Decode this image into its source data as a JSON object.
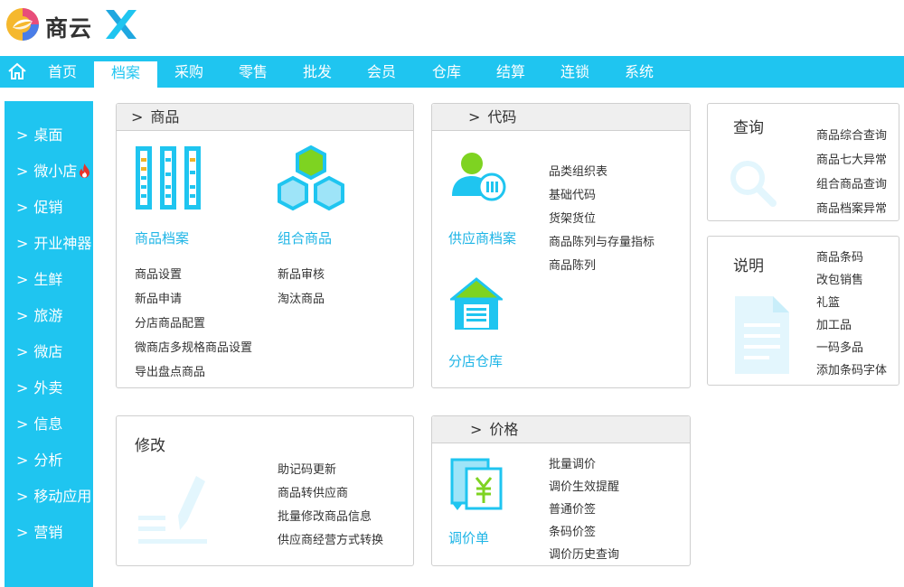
{
  "logo": {
    "text": "商云"
  },
  "topnav": {
    "items": [
      "首页",
      "档案",
      "采购",
      "零售",
      "批发",
      "会员",
      "仓库",
      "结算",
      "连锁",
      "系统"
    ],
    "active": "档案"
  },
  "sidebar": {
    "items": [
      "桌面",
      "微小店",
      "促销",
      "开业神器",
      "生鲜",
      "旅游",
      "微店",
      "外卖",
      "信息",
      "分析",
      "移动应用",
      "营销"
    ],
    "gt": ">"
  },
  "panels": {
    "goods": {
      "title": "商品",
      "archive_title": "商品档案",
      "combo_title": "组合商品",
      "links_left": [
        "商品设置",
        "新品申请",
        "分店商品配置",
        "微商店多规格商品设置",
        "导出盘点商品"
      ],
      "links_right": [
        "新品审核",
        "淘汰商品"
      ]
    },
    "code": {
      "title": "代码",
      "supplier_title": "供应商档案",
      "warehouse_title": "分店仓库",
      "links": [
        "品类组织表",
        "基础代码",
        "货架货位",
        "商品陈列与存量指标",
        "商品陈列"
      ]
    },
    "query": {
      "title": "查询",
      "links": [
        "商品综合查询",
        "商品七大异常",
        "组合商品查询",
        "商品档案异常"
      ]
    },
    "notes": {
      "title": "说明",
      "links": [
        "商品条码",
        "改包销售",
        "礼篮",
        "加工品",
        "一码多品",
        "添加条码字体"
      ]
    },
    "modify": {
      "title": "修改",
      "links": [
        "助记码更新",
        "商品转供应商",
        "批量修改商品信息",
        "供应商经营方式转换"
      ]
    },
    "price": {
      "title": "价格",
      "sheet_title": "调价单",
      "links": [
        "批量调价",
        "调价生效提醒",
        "普通价签",
        "条码价签",
        "调价历史查询"
      ]
    }
  },
  "colors": {
    "accent": "#1fc5f0",
    "link_accent": "#1fb5e6",
    "fire": "#e8332a"
  }
}
